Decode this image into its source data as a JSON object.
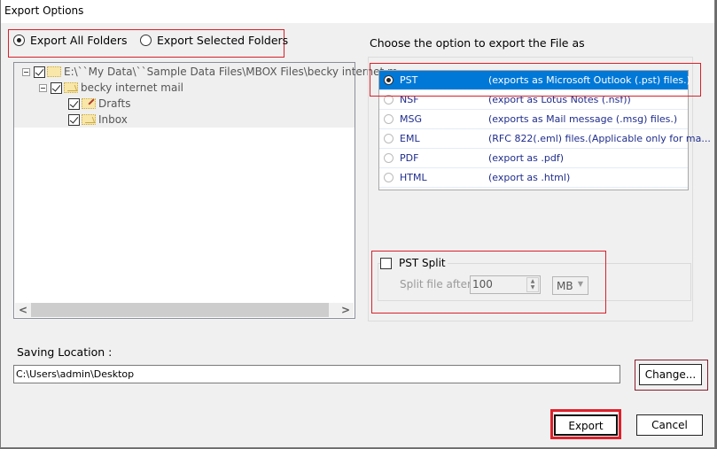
{
  "window": {
    "title": "Export Options"
  },
  "export_mode": {
    "options": [
      {
        "label": "Export All Folders",
        "selected": true
      },
      {
        "label": "Export Selected Folders",
        "selected": false
      }
    ]
  },
  "folder_tree": {
    "nodes": [
      {
        "label": "E:\\``My Data\\``Sample Data Files\\MBOX Files\\becky internet m",
        "checked": true,
        "expanded": true,
        "icon": "folder-icon",
        "level": 0
      },
      {
        "label": "becky internet mail",
        "checked": true,
        "expanded": true,
        "icon": "mail-folder-icon",
        "level": 1
      },
      {
        "label": "Drafts",
        "checked": true,
        "icon": "drafts-folder-icon",
        "level": 2
      },
      {
        "label": "Inbox",
        "checked": true,
        "icon": "inbox-folder-icon",
        "level": 2
      }
    ],
    "scroll_left_glyph": "<",
    "scroll_right_glyph": ">"
  },
  "format_panel": {
    "heading": "Choose the option to export the File as",
    "options": [
      {
        "format": "PST",
        "description": "(exports as Microsoft Outlook (.pst) files.)",
        "selected": true
      },
      {
        "format": "NSF",
        "description": "(export as Lotus Notes (.nsf))",
        "selected": false
      },
      {
        "format": "MSG",
        "description": "(exports as Mail message (.msg) files.)",
        "selected": false
      },
      {
        "format": "EML",
        "description": "(RFC 822(.eml) files.(Applicable only for ma...",
        "selected": false
      },
      {
        "format": "PDF",
        "description": "(export as .pdf)",
        "selected": false
      },
      {
        "format": "HTML",
        "description": "(export as .html)",
        "selected": false
      }
    ]
  },
  "pst_split": {
    "label": "PST Split",
    "checked": false,
    "split_after_label": "Split file after",
    "value": "100",
    "unit": "MB"
  },
  "saving_location": {
    "label": "Saving Location :",
    "value": "C:\\Users\\admin\\Desktop",
    "change_button": "Change..."
  },
  "actions": {
    "export": "Export",
    "cancel": "Cancel"
  },
  "colors": {
    "selection": "#0078d7",
    "highlight_mark": "#d9202a",
    "option_text": "#1f2d8c"
  }
}
